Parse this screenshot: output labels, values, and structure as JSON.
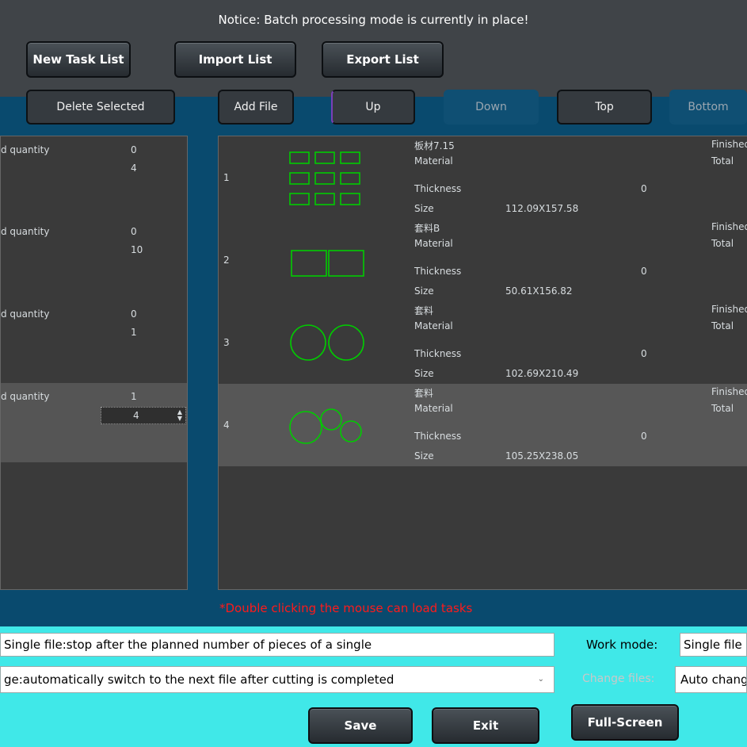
{
  "notice": "Notice: Batch processing mode is currently in place!",
  "top_buttons": [
    "New Task List",
    "Import List",
    "Export List"
  ],
  "toolbar": {
    "delete_selected": "Delete Selected",
    "add_file": "Add File",
    "up": "Up",
    "down": "Down",
    "top": "Top",
    "bottom": "Bottom"
  },
  "left_rows": [
    {
      "label": "d quantity",
      "finished": "0",
      "planned": "4"
    },
    {
      "label": "d quantity",
      "finished": "0",
      "planned": "10"
    },
    {
      "label": "d quantity",
      "finished": "0",
      "planned": "1"
    },
    {
      "label": "d quantity",
      "finished": "1",
      "planned": "4"
    }
  ],
  "files": [
    {
      "index": "1",
      "name": "板材7.15",
      "material_label": "Material",
      "thickness_label": "Thickness",
      "thickness": "0",
      "size_label": "Size",
      "size": "112.09X157.58",
      "finished_label": "Finished",
      "total_label": "Total"
    },
    {
      "index": "2",
      "name": "套料B",
      "material_label": "Material",
      "thickness_label": "Thickness",
      "thickness": "0",
      "size_label": "Size",
      "size": "50.61X156.82",
      "finished_label": "Finished",
      "total_label": "Total"
    },
    {
      "index": "3",
      "name": "套料",
      "material_label": "Material",
      "thickness_label": "Thickness",
      "thickness": "0",
      "size_label": "Size",
      "size": "102.69X210.49",
      "finished_label": "Finished",
      "total_label": "Total"
    },
    {
      "index": "4",
      "name": "套料",
      "material_label": "Material",
      "thickness_label": "Thickness",
      "thickness": "0",
      "size_label": "Size",
      "size": "105.25X238.05",
      "finished_label": "Finished",
      "total_label": "Total"
    }
  ],
  "hint": "*Double clicking the mouse can load tasks",
  "work_mode_label": "Work mode:",
  "work_mode_value": "Single file:stop after the planned number of pieces of a single",
  "work_mode_right": "Single file",
  "change_files_label": "Change files:",
  "change_files_value": "ge:automatically switch to the next file after cutting is completed",
  "change_files_right": "Auto chang",
  "footer": {
    "save": "Save",
    "exit": "Exit",
    "fullscreen": "Full-Screen"
  },
  "colors": {
    "thumbnail_stroke": "#00cc00",
    "hint": "#ff1a1a",
    "footer_bg": "#40e8e8",
    "panel_bg": "#094a6e"
  }
}
